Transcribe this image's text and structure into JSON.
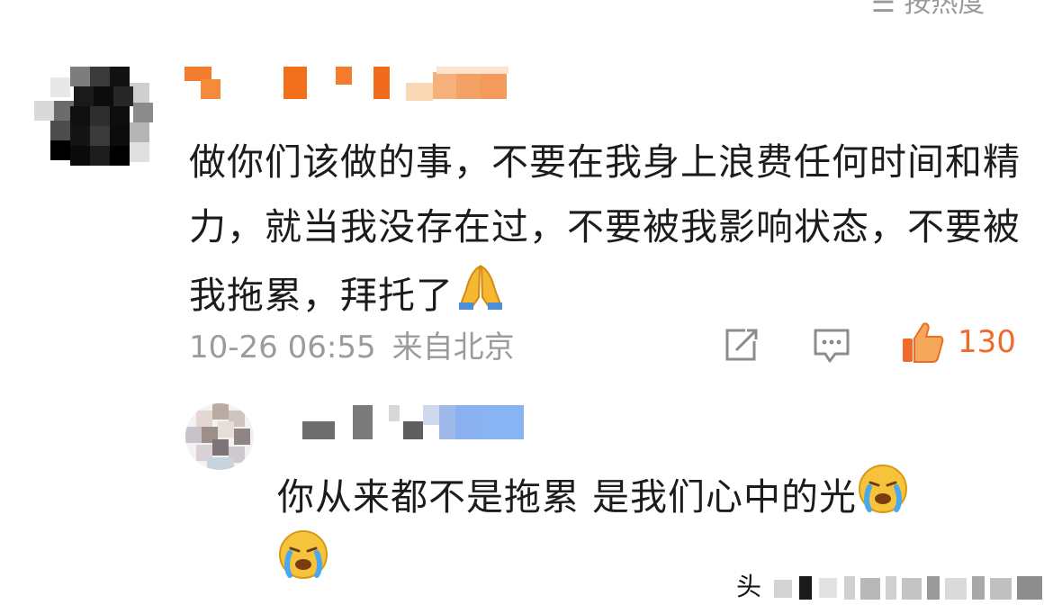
{
  "header": {
    "sort_label": "按热度"
  },
  "comment": {
    "text": "做你们该做的事，不要在我身上浪费任何时间和精力，就当我没存在过，不要被我影响状态，不要被我拖累，拜托了",
    "emoji": "pray-emoji",
    "timestamp": "10-26 06:55",
    "location": "来自北京",
    "like_count": "130",
    "reply": {
      "text": "你从来都不是拖累 是我们心中的光",
      "emoji": "crying-face-emoji"
    }
  },
  "watermark": {
    "label": "头"
  },
  "colors": {
    "accent": "#ef6a2b",
    "meta": "#9b9b9b",
    "text": "#1c1c1c"
  }
}
